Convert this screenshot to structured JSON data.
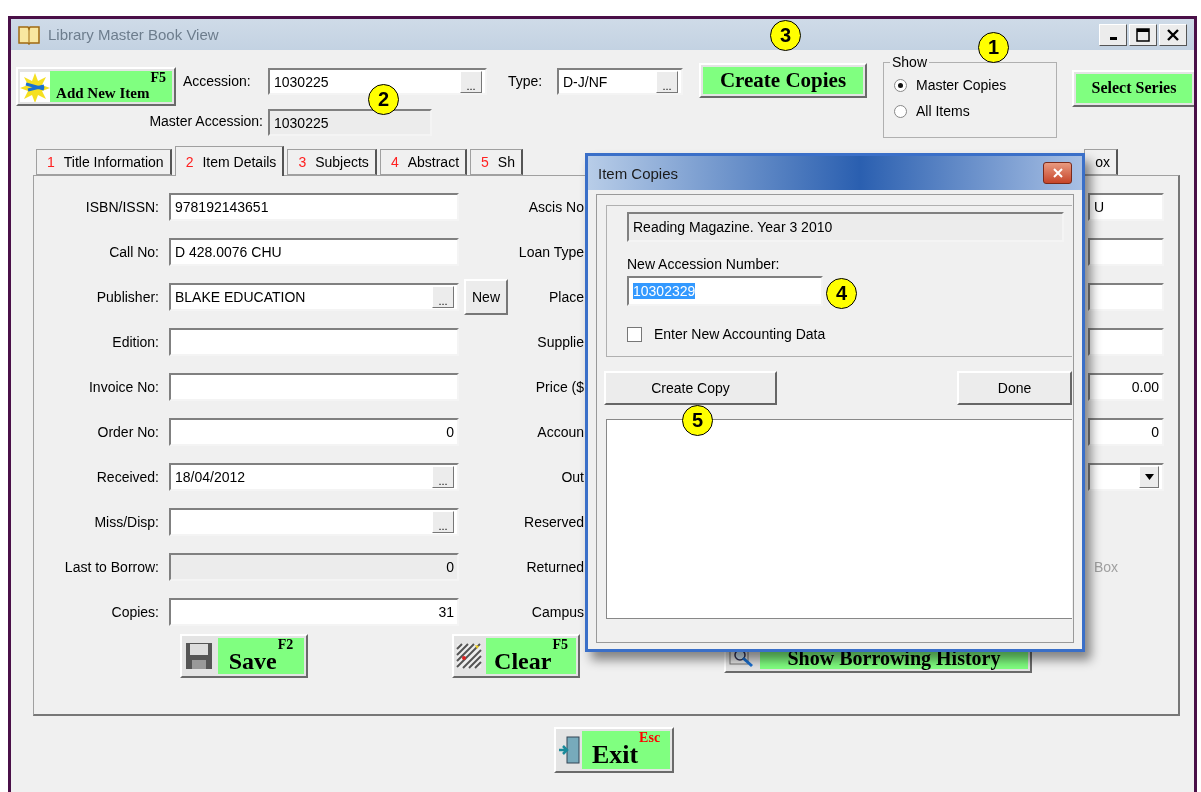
{
  "window": {
    "title": "Library Master Book View"
  },
  "header": {
    "add_button": {
      "label": "Add New Item",
      "key": "F5"
    },
    "accession": {
      "label": "Accession:",
      "value": "1030225",
      "browse": "..."
    },
    "type": {
      "label": "Type:",
      "value": "D-J/NF",
      "browse": "..."
    },
    "create_copies": "Create Copies",
    "show": {
      "title": "Show",
      "options": [
        {
          "label": "Master Copies",
          "selected": true
        },
        {
          "label": "All Items",
          "selected": false
        }
      ]
    },
    "select_series": "Select Series",
    "master_accession": {
      "label": "Master Accession:",
      "value": "1030225"
    }
  },
  "tabs": [
    {
      "number": "1",
      "label": "Title Information",
      "selected": false
    },
    {
      "number": "2",
      "label": "Item Details",
      "selected": true
    },
    {
      "number": "3",
      "label": "Subjects",
      "selected": false
    },
    {
      "number": "4",
      "label": "Abstract",
      "selected": false
    },
    {
      "number": "5",
      "label": "Sh",
      "selected": false
    },
    {
      "label": "ox",
      "selected": false
    }
  ],
  "form": {
    "left": [
      {
        "label": "ISBN/ISSN:",
        "value": "978192143651"
      },
      {
        "label": "Call No:",
        "value": "D 428.0076 CHU"
      },
      {
        "label": "Publisher:",
        "value": "BLAKE EDUCATION",
        "browse": "...",
        "new_button": "New"
      },
      {
        "label": "Edition:"
      },
      {
        "label": "Invoice No:"
      },
      {
        "label": "Order No:",
        "value": "0",
        "numeric": true
      },
      {
        "label": "Received:",
        "value": "18/04/2012",
        "browse": "..."
      },
      {
        "label": "Miss/Disp:",
        "browse": "..."
      },
      {
        "label": "Last to Borrow:",
        "value": "0",
        "numeric": true,
        "disabled": true
      },
      {
        "label": "Copies:",
        "value": "31",
        "numeric": true
      }
    ],
    "middle_labels": [
      "Ascis No",
      "Loan Type",
      "Place",
      "Supplie",
      "Price ($",
      "Accoun",
      "Out",
      "Reserved",
      "Returned",
      "Campus"
    ],
    "right": [
      {
        "kind": "field",
        "value": "U"
      },
      {
        "kind": "field"
      },
      {
        "kind": "field"
      },
      {
        "kind": "field"
      },
      {
        "kind": "field",
        "value": "0.00",
        "numeric": true
      },
      {
        "kind": "field",
        "value": "0",
        "numeric": true
      },
      {
        "kind": "dropdown"
      },
      {
        "kind": "blank"
      },
      {
        "kind": "label",
        "value": "Box",
        "disabled": true
      },
      {
        "kind": "blank"
      }
    ]
  },
  "actions": [
    {
      "kind": "save",
      "label": "Save",
      "key": "F2"
    },
    {
      "kind": "clear",
      "label": "Clear",
      "key": "F5"
    },
    {
      "kind": "history",
      "label": "Show Borrowing History"
    }
  ],
  "exit": {
    "label": "Exit",
    "key": "Esc"
  },
  "dialog": {
    "title": "Item Copies",
    "item_title": "Reading Magazine. Year 3 2010",
    "accession_label": "New Accession Number:",
    "accession_value": "10302329",
    "accession_selected": true,
    "accounting": {
      "label": "Enter New Accounting Data",
      "checked": false
    },
    "create_button": "Create Copy",
    "done_button": "Done"
  },
  "callouts": [
    "1",
    "2",
    "3",
    "4",
    "5"
  ]
}
